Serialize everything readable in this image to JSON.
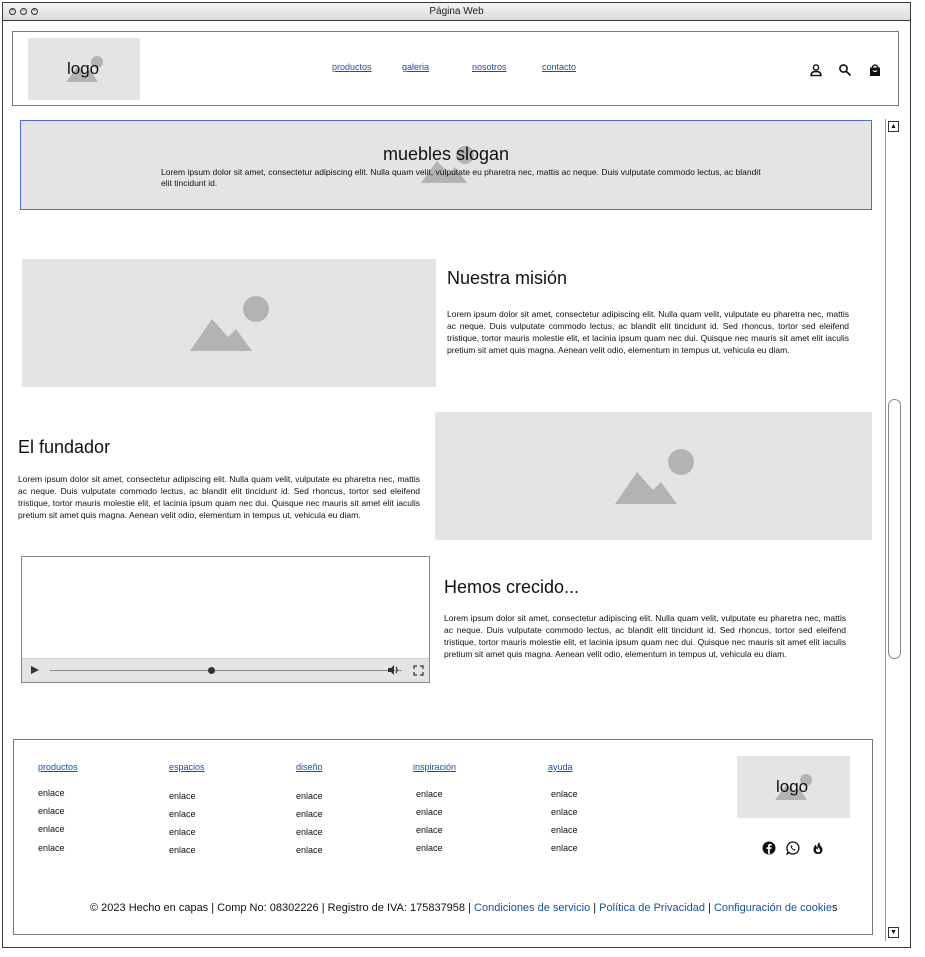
{
  "window": {
    "title": "Página Web"
  },
  "header": {
    "logo_text": "logo",
    "nav": [
      "productos",
      "galeria",
      "nosotros",
      "contacto"
    ],
    "icons": [
      "user-icon",
      "search-icon",
      "shopping-bag-icon"
    ]
  },
  "hero": {
    "title": "muebles slogan",
    "text": "Lorem ipsum dolor sit amet, consectetur adipiscing elit. Nulla quam velit, vulputate eu pharetra nec, mattis ac neque. Duis vulputate commodo lectus, ac blandit elit tincidunt id."
  },
  "sections": {
    "mision": {
      "title": "Nuestra misión",
      "text": "Lorem ipsum dolor sit amet, consectetur adipiscing elit. Nulla quam velit, vulputate eu pharetra nec, mattis ac neque. Duis vulputate commodo lectus, ac blandit elit tincidunt id. Sed rhoncus, tortor sed eleifend tristique, tortor mauris molestie elit, et lacinia ipsum quam nec dui. Quisque nec mauris sit amet elit iaculis pretium sit amet quis magna. Aenean velit odio, elementum in tempus ut, vehicula eu diam."
    },
    "fundador": {
      "title": "El fundador",
      "text": "Lorem ipsum dolor sit amet, consectetur adipiscing elit. Nulla quam velit, vulputate eu pharetra nec, mattis ac neque. Duis vulputate commodo lectus, ac blandit elit tincidunt id. Sed rhoncus, tortor sed eleifend tristique, tortor mauris molestie elit, et lacinia ipsum quam nec dui. Quisque nec mauris sit amet elit iaculis pretium sit amet quis magna. Aenean velit odio, elementum in tempus ut, vehicula eu diam."
    },
    "crecido": {
      "title": "Hemos crecido...",
      "text": "Lorem ipsum dolor sit amet, consectetur adipiscing elit. Nulla quam velit, vulputate eu pharetra nec, mattis ac neque. Duis vulputate commodo lectus, ac blandit elit tincidunt id. Sed rhoncus, tortor sed eleifend tristique, tortor mauris molestie elit, et lacinia ipsum quam nec dui. Quisque nec mauris sit amet elit iaculis pretium sit amet quis magna. Aenean velit odio, elementum in tempus ut, vehicula eu diam."
    }
  },
  "footer": {
    "columns": [
      {
        "heading": "productos",
        "links": [
          "enlace",
          "enlace",
          "enlace",
          "enlace"
        ]
      },
      {
        "heading": "espacios",
        "links": [
          "enlace",
          "enlace",
          "enlace",
          "enlace"
        ]
      },
      {
        "heading": "diseño",
        "links": [
          "enlace",
          "enlace",
          "enlace",
          "enlace"
        ]
      },
      {
        "heading": "inspiración",
        "links": [
          "enlace",
          "enlace",
          "enlace",
          "enlace"
        ]
      },
      {
        "heading": "ayuda",
        "links": [
          "enlace",
          "enlace",
          "enlace",
          "enlace"
        ]
      }
    ],
    "logo_text": "logo",
    "social_icons": [
      "facebook-icon",
      "whatsapp-icon",
      "tinder-icon"
    ],
    "copyright": "© 2023 Hecho en capas | Comp No: 08302226 | Registro de IVA: 175837958 | ",
    "legal_links": [
      "Condiciones de servicio",
      "Política de Privacidad",
      "Configuración de cookie"
    ],
    "legal_suffix": "s",
    "separator": " | "
  },
  "colors": {
    "link": "#1a4fa3",
    "placeholder": "#e4e4e4",
    "hero_border": "#4a6fd0"
  }
}
